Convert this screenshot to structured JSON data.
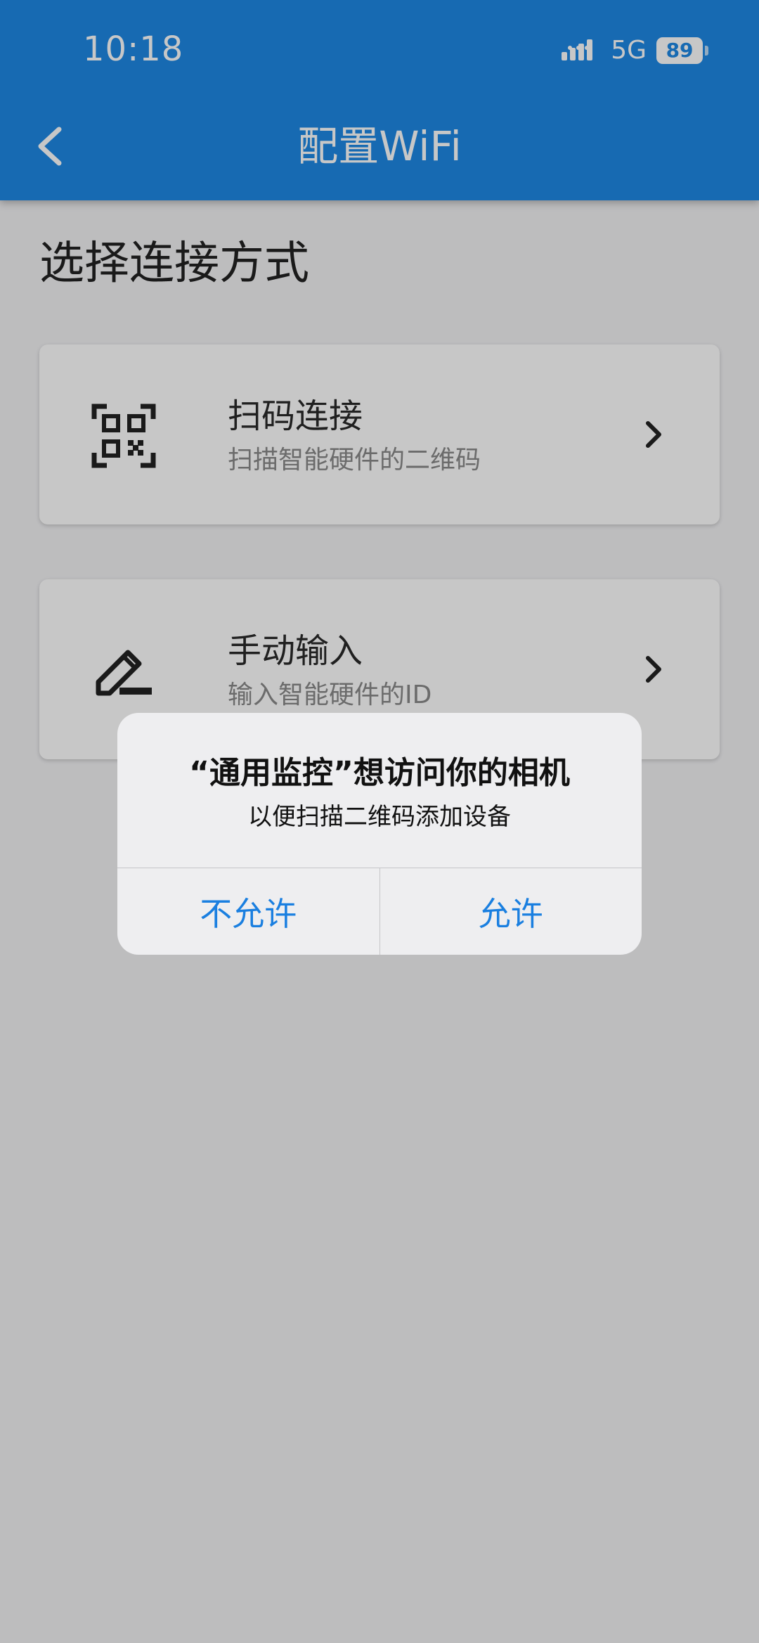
{
  "status_bar": {
    "time": "10:18",
    "signal_icon": "signal-bars-icon",
    "network": "5G",
    "battery_level": "89"
  },
  "app_bar": {
    "back_icon": "back-arrow-icon",
    "title": "配置WiFi"
  },
  "content": {
    "heading": "选择连接方式",
    "options": [
      {
        "icon": "qr-code-icon",
        "title": "扫码连接",
        "subtitle": "扫描智能硬件的二维码",
        "chevron_icon": "chevron-right-icon"
      },
      {
        "icon": "edit-pencil-icon",
        "title": "手动输入",
        "subtitle": "输入智能硬件的ID",
        "chevron_icon": "chevron-right-icon"
      }
    ]
  },
  "dialog": {
    "title": "“通用监控”想访问你的相机",
    "message": "以便扫描二维码添加设备",
    "deny_label": "不允许",
    "allow_label": "允许"
  },
  "colors": {
    "primary": "#1e88e5",
    "dialog_button": "#1a7fe0"
  }
}
